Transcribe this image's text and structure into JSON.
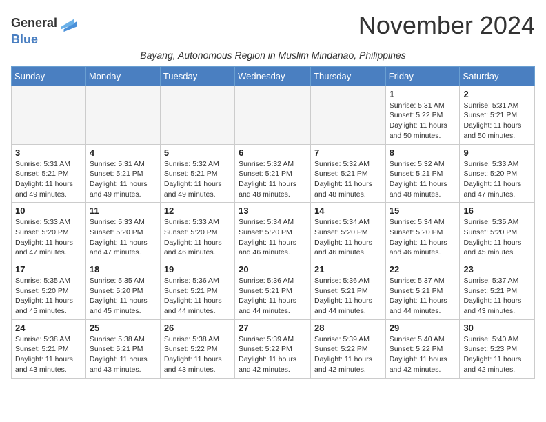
{
  "logo": {
    "line1": "General",
    "line2": "Blue"
  },
  "title": "November 2024",
  "subtitle": "Bayang, Autonomous Region in Muslim Mindanao, Philippines",
  "weekdays": [
    "Sunday",
    "Monday",
    "Tuesday",
    "Wednesday",
    "Thursday",
    "Friday",
    "Saturday"
  ],
  "weeks": [
    [
      {
        "day": "",
        "info": ""
      },
      {
        "day": "",
        "info": ""
      },
      {
        "day": "",
        "info": ""
      },
      {
        "day": "",
        "info": ""
      },
      {
        "day": "",
        "info": ""
      },
      {
        "day": "1",
        "info": "Sunrise: 5:31 AM\nSunset: 5:22 PM\nDaylight: 11 hours\nand 50 minutes."
      },
      {
        "day": "2",
        "info": "Sunrise: 5:31 AM\nSunset: 5:21 PM\nDaylight: 11 hours\nand 50 minutes."
      }
    ],
    [
      {
        "day": "3",
        "info": "Sunrise: 5:31 AM\nSunset: 5:21 PM\nDaylight: 11 hours\nand 49 minutes."
      },
      {
        "day": "4",
        "info": "Sunrise: 5:31 AM\nSunset: 5:21 PM\nDaylight: 11 hours\nand 49 minutes."
      },
      {
        "day": "5",
        "info": "Sunrise: 5:32 AM\nSunset: 5:21 PM\nDaylight: 11 hours\nand 49 minutes."
      },
      {
        "day": "6",
        "info": "Sunrise: 5:32 AM\nSunset: 5:21 PM\nDaylight: 11 hours\nand 48 minutes."
      },
      {
        "day": "7",
        "info": "Sunrise: 5:32 AM\nSunset: 5:21 PM\nDaylight: 11 hours\nand 48 minutes."
      },
      {
        "day": "8",
        "info": "Sunrise: 5:32 AM\nSunset: 5:21 PM\nDaylight: 11 hours\nand 48 minutes."
      },
      {
        "day": "9",
        "info": "Sunrise: 5:33 AM\nSunset: 5:20 PM\nDaylight: 11 hours\nand 47 minutes."
      }
    ],
    [
      {
        "day": "10",
        "info": "Sunrise: 5:33 AM\nSunset: 5:20 PM\nDaylight: 11 hours\nand 47 minutes."
      },
      {
        "day": "11",
        "info": "Sunrise: 5:33 AM\nSunset: 5:20 PM\nDaylight: 11 hours\nand 47 minutes."
      },
      {
        "day": "12",
        "info": "Sunrise: 5:33 AM\nSunset: 5:20 PM\nDaylight: 11 hours\nand 46 minutes."
      },
      {
        "day": "13",
        "info": "Sunrise: 5:34 AM\nSunset: 5:20 PM\nDaylight: 11 hours\nand 46 minutes."
      },
      {
        "day": "14",
        "info": "Sunrise: 5:34 AM\nSunset: 5:20 PM\nDaylight: 11 hours\nand 46 minutes."
      },
      {
        "day": "15",
        "info": "Sunrise: 5:34 AM\nSunset: 5:20 PM\nDaylight: 11 hours\nand 46 minutes."
      },
      {
        "day": "16",
        "info": "Sunrise: 5:35 AM\nSunset: 5:20 PM\nDaylight: 11 hours\nand 45 minutes."
      }
    ],
    [
      {
        "day": "17",
        "info": "Sunrise: 5:35 AM\nSunset: 5:20 PM\nDaylight: 11 hours\nand 45 minutes."
      },
      {
        "day": "18",
        "info": "Sunrise: 5:35 AM\nSunset: 5:20 PM\nDaylight: 11 hours\nand 45 minutes."
      },
      {
        "day": "19",
        "info": "Sunrise: 5:36 AM\nSunset: 5:21 PM\nDaylight: 11 hours\nand 44 minutes."
      },
      {
        "day": "20",
        "info": "Sunrise: 5:36 AM\nSunset: 5:21 PM\nDaylight: 11 hours\nand 44 minutes."
      },
      {
        "day": "21",
        "info": "Sunrise: 5:36 AM\nSunset: 5:21 PM\nDaylight: 11 hours\nand 44 minutes."
      },
      {
        "day": "22",
        "info": "Sunrise: 5:37 AM\nSunset: 5:21 PM\nDaylight: 11 hours\nand 44 minutes."
      },
      {
        "day": "23",
        "info": "Sunrise: 5:37 AM\nSunset: 5:21 PM\nDaylight: 11 hours\nand 43 minutes."
      }
    ],
    [
      {
        "day": "24",
        "info": "Sunrise: 5:38 AM\nSunset: 5:21 PM\nDaylight: 11 hours\nand 43 minutes."
      },
      {
        "day": "25",
        "info": "Sunrise: 5:38 AM\nSunset: 5:21 PM\nDaylight: 11 hours\nand 43 minutes."
      },
      {
        "day": "26",
        "info": "Sunrise: 5:38 AM\nSunset: 5:22 PM\nDaylight: 11 hours\nand 43 minutes."
      },
      {
        "day": "27",
        "info": "Sunrise: 5:39 AM\nSunset: 5:22 PM\nDaylight: 11 hours\nand 42 minutes."
      },
      {
        "day": "28",
        "info": "Sunrise: 5:39 AM\nSunset: 5:22 PM\nDaylight: 11 hours\nand 42 minutes."
      },
      {
        "day": "29",
        "info": "Sunrise: 5:40 AM\nSunset: 5:22 PM\nDaylight: 11 hours\nand 42 minutes."
      },
      {
        "day": "30",
        "info": "Sunrise: 5:40 AM\nSunset: 5:23 PM\nDaylight: 11 hours\nand 42 minutes."
      }
    ]
  ]
}
